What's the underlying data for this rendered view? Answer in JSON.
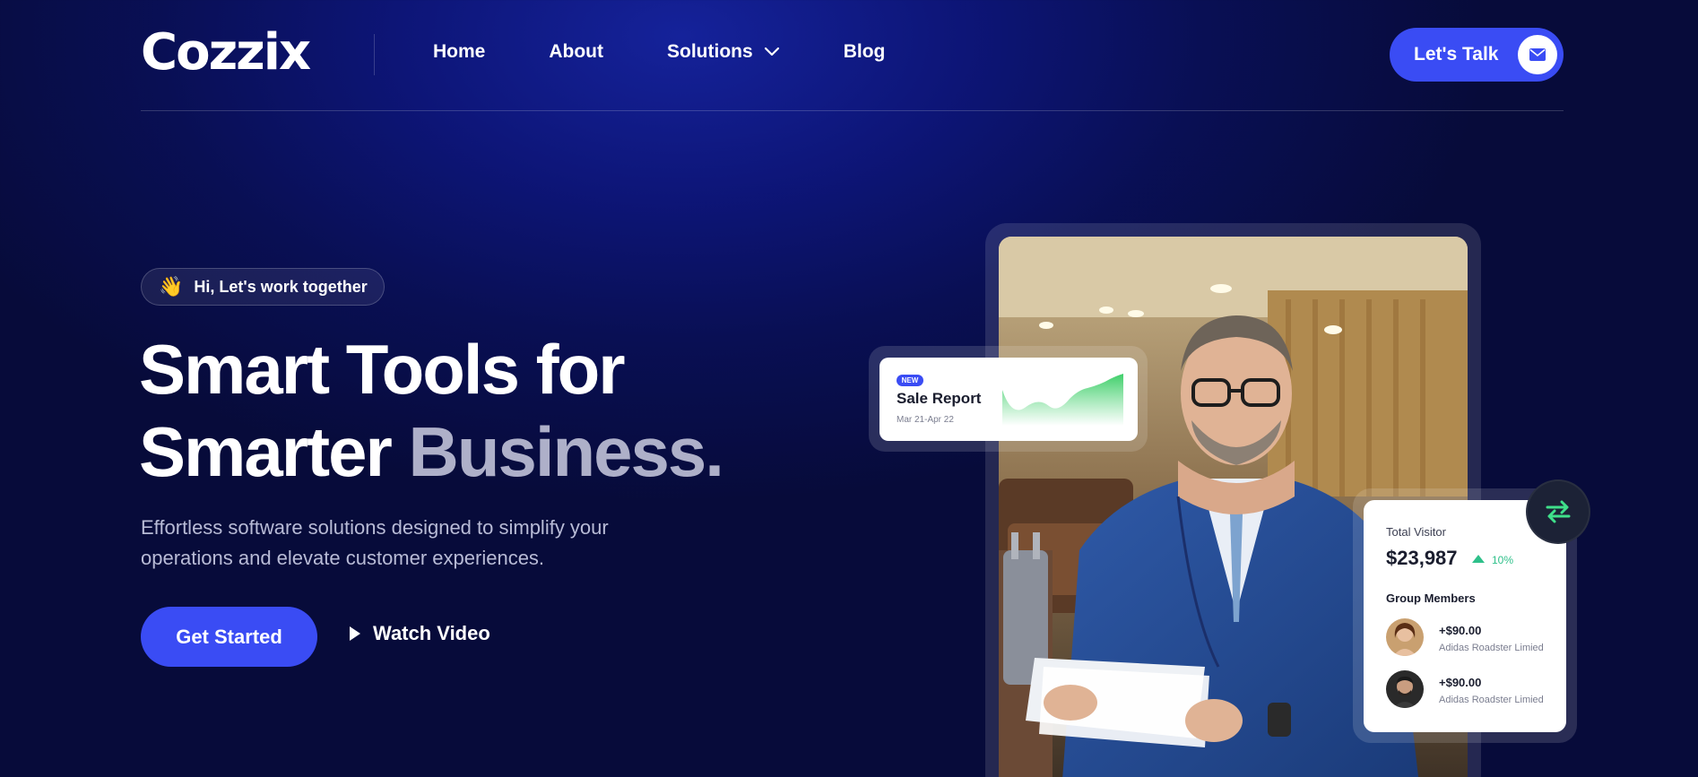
{
  "brand": {
    "logo_text": "Cozzix"
  },
  "nav": {
    "items": [
      {
        "label": "Home"
      },
      {
        "label": "About"
      },
      {
        "label": "Solutions"
      },
      {
        "label": "Blog"
      }
    ],
    "cta_label": "Let's Talk",
    "cta_icon": "mail-icon"
  },
  "hero": {
    "badge_emoji": "👋",
    "badge_text": "Hi, Let's work together",
    "headline_line1": "Smart Tools for",
    "headline_line2_a": "Smarter ",
    "headline_line2_b": "Business.",
    "subtext": "Effortless software solutions designed to simplify your operations and elevate customer experiences.",
    "primary_cta": "Get Started",
    "secondary_cta": "Watch Video"
  },
  "sale_card": {
    "tag": "NEW",
    "title": "Sale Report",
    "date_range": "Mar 21-Apr 22"
  },
  "visitor_card": {
    "label": "Total Visitor",
    "amount": "$23,987",
    "change": "10%",
    "group_title": "Group Members",
    "members": [
      {
        "amount": "+$90.00",
        "name": "Adidas Roadster Limied"
      },
      {
        "amount": "+$90.00",
        "name": "Adidas Roadster Limied"
      }
    ]
  },
  "colors": {
    "accent": "#3a4cf4",
    "background": "#090f54",
    "positive": "#2ec08a"
  }
}
